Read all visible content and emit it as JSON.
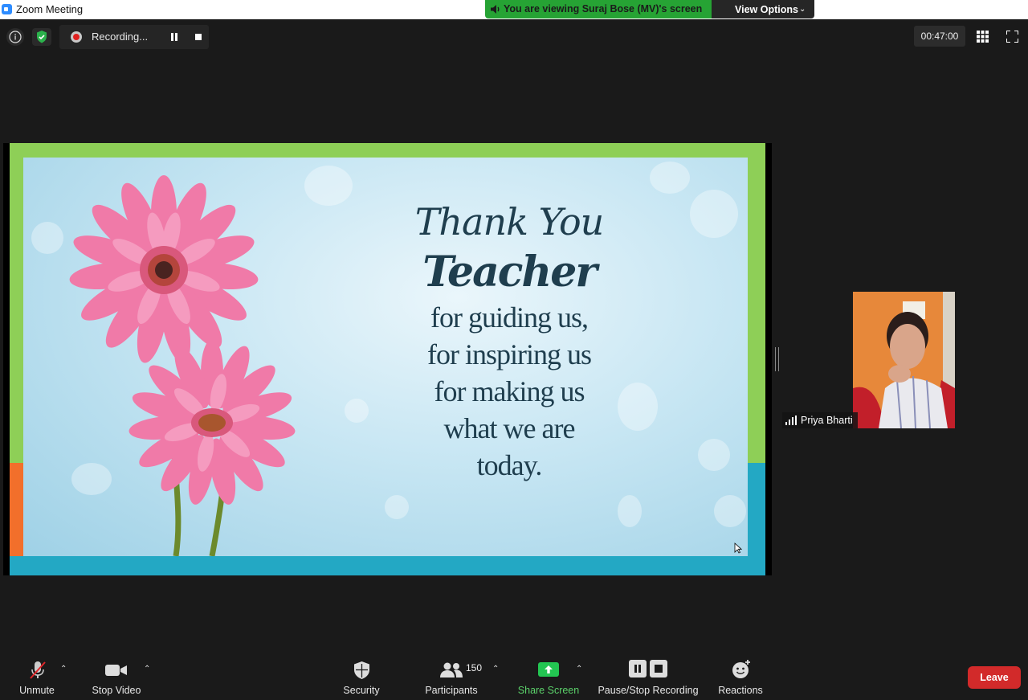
{
  "window": {
    "title": "Zoom Meeting"
  },
  "banner": {
    "viewing_text": "You are viewing Suraj  Bose (MV)'s screen",
    "view_options": "View Options"
  },
  "recording": {
    "label": "Recording..."
  },
  "timer": "00:47:00",
  "slide": {
    "line1": "Thank You",
    "line2": "Teacher",
    "lines": [
      "for guiding us,",
      "for inspiring us",
      "for making us",
      "what we are",
      "today."
    ]
  },
  "participant": {
    "name": "Priya Bharti"
  },
  "toolbar": {
    "unmute": "Unmute",
    "stop_video": "Stop Video",
    "security": "Security",
    "participants": "Participants",
    "participants_count": "150",
    "share_screen": "Share Screen",
    "pause_stop_recording": "Pause/Stop Recording",
    "reactions": "Reactions",
    "leave": "Leave"
  },
  "colors": {
    "banner_green": "#26a334",
    "leave_red": "#d22a2a",
    "share_green": "#23c552",
    "security_shield": "#2bb24c"
  }
}
